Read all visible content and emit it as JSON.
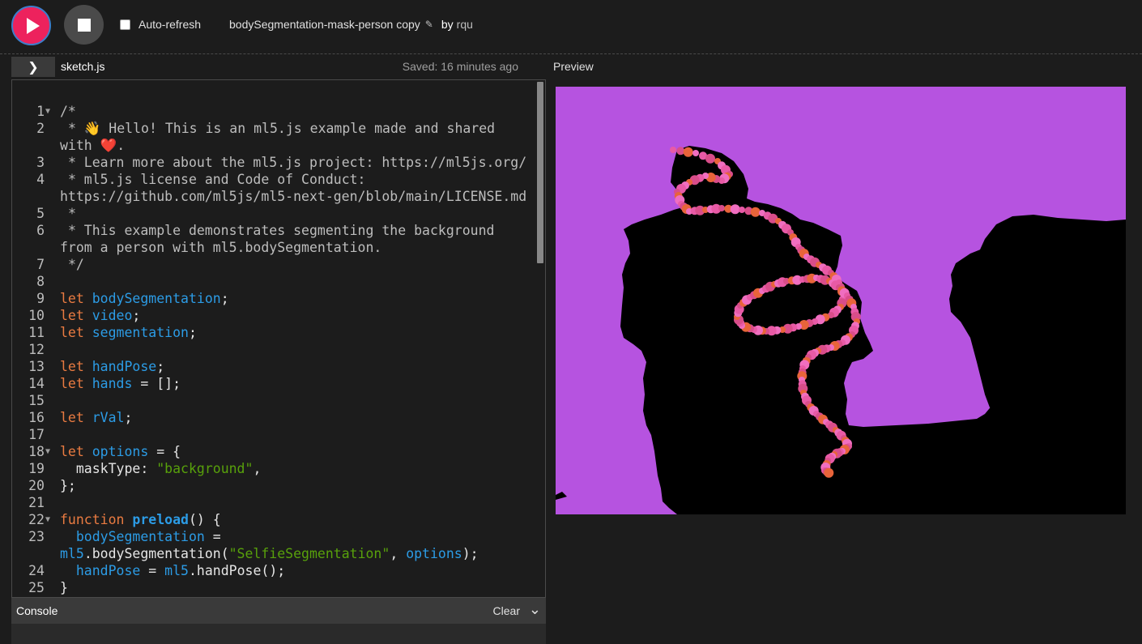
{
  "toolbar": {
    "auto_refresh_label": "Auto-refresh",
    "project_name": "bodySegmentation-mask-person copy",
    "by_label": "by",
    "author": "rqu"
  },
  "editor": {
    "file_name": "sketch.js",
    "saved_status": "Saved: 16 minutes ago",
    "lines": [
      {
        "n": "1",
        "fold": "▼",
        "parts": [
          {
            "c": "com",
            "t": "/*"
          }
        ]
      },
      {
        "n": "2",
        "parts": [
          {
            "c": "com",
            "t": " * 👋 Hello! This is an ml5.js example made and shared with ❤️."
          }
        ]
      },
      {
        "n": "3",
        "parts": [
          {
            "c": "com",
            "t": " * Learn more about the ml5.js project: https://ml5js.org/"
          }
        ]
      },
      {
        "n": "4",
        "parts": [
          {
            "c": "com",
            "t": " * ml5.js license and Code of Conduct: https://github.com/ml5js/ml5-next-gen/blob/main/LICENSE.md"
          }
        ]
      },
      {
        "n": "5",
        "parts": [
          {
            "c": "com",
            "t": " *"
          }
        ]
      },
      {
        "n": "6",
        "parts": [
          {
            "c": "com",
            "t": " * This example demonstrates segmenting the background from a person with ml5.bodySegmentation."
          }
        ]
      },
      {
        "n": "7",
        "parts": [
          {
            "c": "com",
            "t": " */"
          }
        ]
      },
      {
        "n": "8",
        "parts": []
      },
      {
        "n": "9",
        "parts": [
          {
            "c": "kw",
            "t": "let "
          },
          {
            "c": "var",
            "t": "bodySegmentation"
          },
          {
            "c": "",
            "t": ";"
          }
        ]
      },
      {
        "n": "10",
        "parts": [
          {
            "c": "kw",
            "t": "let "
          },
          {
            "c": "var",
            "t": "video"
          },
          {
            "c": "",
            "t": ";"
          }
        ]
      },
      {
        "n": "11",
        "parts": [
          {
            "c": "kw",
            "t": "let "
          },
          {
            "c": "var",
            "t": "segmentation"
          },
          {
            "c": "",
            "t": ";"
          }
        ]
      },
      {
        "n": "12",
        "parts": []
      },
      {
        "n": "13",
        "parts": [
          {
            "c": "kw",
            "t": "let "
          },
          {
            "c": "var",
            "t": "handPose"
          },
          {
            "c": "",
            "t": ";"
          }
        ]
      },
      {
        "n": "14",
        "parts": [
          {
            "c": "kw",
            "t": "let "
          },
          {
            "c": "var",
            "t": "hands"
          },
          {
            "c": "",
            "t": " = [];"
          }
        ]
      },
      {
        "n": "15",
        "parts": []
      },
      {
        "n": "16",
        "parts": [
          {
            "c": "kw",
            "t": "let "
          },
          {
            "c": "var",
            "t": "rVal"
          },
          {
            "c": "",
            "t": ";"
          }
        ]
      },
      {
        "n": "17",
        "parts": []
      },
      {
        "n": "18",
        "fold": "▼",
        "parts": [
          {
            "c": "kw",
            "t": "let "
          },
          {
            "c": "var",
            "t": "options"
          },
          {
            "c": "",
            "t": " = {"
          }
        ]
      },
      {
        "n": "19",
        "parts": [
          {
            "c": "",
            "t": "  maskType: "
          },
          {
            "c": "str",
            "t": "\"background\""
          },
          {
            "c": "",
            "t": ","
          }
        ]
      },
      {
        "n": "20",
        "parts": [
          {
            "c": "",
            "t": "};"
          }
        ]
      },
      {
        "n": "21",
        "parts": []
      },
      {
        "n": "22",
        "fold": "▼",
        "parts": [
          {
            "c": "kw",
            "t": "function "
          },
          {
            "c": "fn",
            "t": "preload"
          },
          {
            "c": "",
            "t": "() {"
          }
        ]
      },
      {
        "n": "23",
        "parts": [
          {
            "c": "",
            "t": "  "
          },
          {
            "c": "var",
            "t": "bodySegmentation"
          },
          {
            "c": "",
            "t": " = "
          },
          {
            "c": "var",
            "t": "ml5"
          },
          {
            "c": "",
            "t": ".bodySegmentation("
          },
          {
            "c": "str",
            "t": "\"SelfieSegmentation\""
          },
          {
            "c": "",
            "t": ", "
          },
          {
            "c": "var",
            "t": "options"
          },
          {
            "c": "",
            "t": ");"
          }
        ]
      },
      {
        "n": "24",
        "parts": [
          {
            "c": "",
            "t": "  "
          },
          {
            "c": "var",
            "t": "handPose"
          },
          {
            "c": "",
            "t": " = "
          },
          {
            "c": "var",
            "t": "ml5"
          },
          {
            "c": "",
            "t": ".handPose();"
          }
        ]
      },
      {
        "n": "25",
        "parts": [
          {
            "c": "",
            "t": "}"
          }
        ]
      }
    ]
  },
  "preview": {
    "label": "Preview",
    "background_color": "#b653e0",
    "mask_color": "#000000",
    "dot_colors": [
      "#e85aa6",
      "#d94d8a",
      "#e8643a",
      "#f06ec0"
    ]
  },
  "console": {
    "label": "Console",
    "clear_label": "Clear"
  },
  "colors": {
    "accent": "#ed225d",
    "keyword": "#ea7b41",
    "variable": "#2c9ce6",
    "string": "#58a10b",
    "comment": "#bdbdbd"
  }
}
